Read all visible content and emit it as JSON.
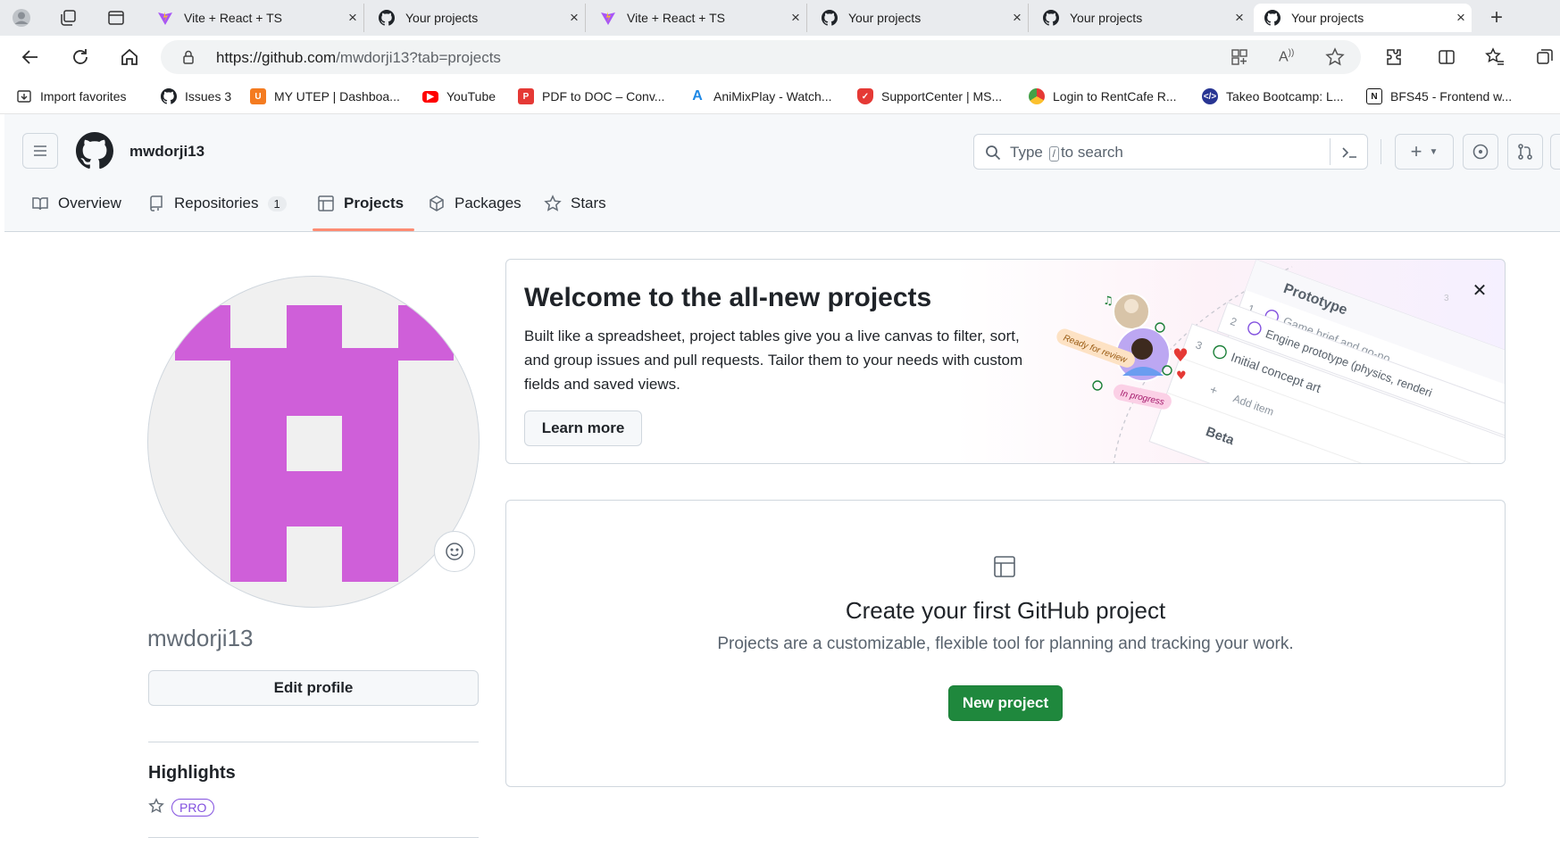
{
  "browser": {
    "tabs": [
      {
        "title": "Vite + React + TS",
        "icon": "vite-icon"
      },
      {
        "title": "Your projects",
        "icon": "github-icon"
      },
      {
        "title": "Vite + React + TS",
        "icon": "vite-icon"
      },
      {
        "title": "Your projects",
        "icon": "github-icon"
      },
      {
        "title": "Your projects",
        "icon": "github-icon"
      },
      {
        "title": "Your projects",
        "icon": "github-icon",
        "active": true
      }
    ],
    "url_host": "https://github.com",
    "url_path": "/mwdorji13?tab=projects",
    "bookmarks": [
      {
        "label": "Import favorites"
      },
      {
        "label": "Issues 3"
      },
      {
        "label": "MY UTEP | Dashboa..."
      },
      {
        "label": "YouTube"
      },
      {
        "label": "PDF to DOC – Conv..."
      },
      {
        "label": "AniMixPlay - Watch..."
      },
      {
        "label": "SupportCenter | MS..."
      },
      {
        "label": "Login to RentCafe R..."
      },
      {
        "label": "Takeo Bootcamp: L..."
      },
      {
        "label": "BFS45 - Frontend w..."
      }
    ]
  },
  "header": {
    "username": "mwdorji13",
    "search_prefix": "Type",
    "search_key": "/",
    "search_suffix": "to search"
  },
  "nav": {
    "overview": "Overview",
    "repositories": "Repositories",
    "repositories_count": "1",
    "projects": "Projects",
    "packages": "Packages",
    "stars": "Stars"
  },
  "profile": {
    "name": "mwdorji13",
    "edit_label": "Edit profile",
    "highlights_title": "Highlights",
    "pro_badge": "PRO",
    "avatar_color": "#cf5fd9"
  },
  "welcome": {
    "title": "Welcome to the all-new projects",
    "description": "Built like a spreadsheet, project tables give you a live canvas to filter, sort, and group issues and pull requests. Tailor them to your needs with custom fields and saved views.",
    "learn_more": "Learn more",
    "illustration": {
      "prototype": "Prototype",
      "row1_num": "1",
      "row1": "Game brief and go-no",
      "row2_num": "2",
      "row2": "Engine prototype (physics, renderi",
      "row3_num": "3",
      "row3": "Initial concept art",
      "add_item": "Add item",
      "ready_for_review": "Ready for review",
      "in_progress": "In progress",
      "beta": "Beta"
    }
  },
  "empty_state": {
    "title": "Create your first GitHub project",
    "description": "Projects are a customizable, flexible tool for planning and tracking your work.",
    "button": "New project"
  },
  "colors": {
    "primary_green": "#1f883d",
    "nav_underline": "#fd8c73",
    "pro_purple": "#8250df"
  }
}
